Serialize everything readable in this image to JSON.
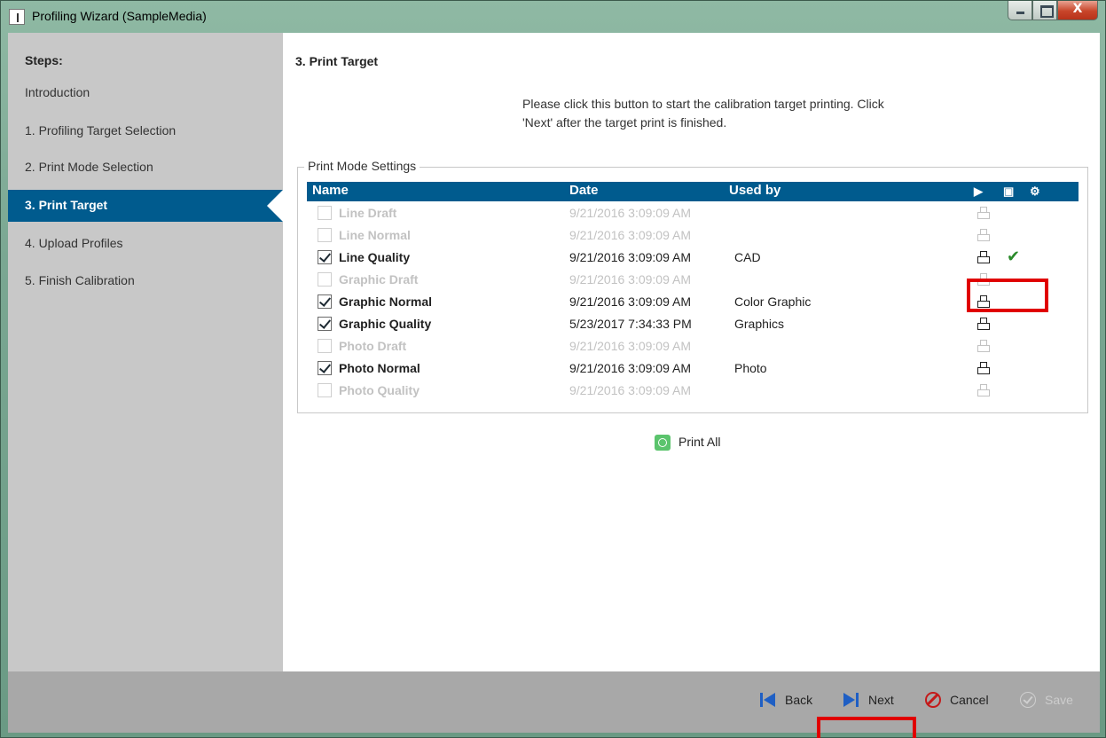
{
  "window": {
    "title": "Profiling Wizard (SampleMedia)",
    "close_glyph": "X"
  },
  "sidebar": {
    "title": "Steps:",
    "items": [
      {
        "label": "Introduction"
      },
      {
        "label": "1. Profiling Target Selection"
      },
      {
        "label": "2. Print Mode Selection"
      },
      {
        "label": "3. Print Target",
        "active": true
      },
      {
        "label": "4. Upload Profiles"
      },
      {
        "label": "5. Finish Calibration"
      }
    ]
  },
  "main": {
    "title": "3. Print Target",
    "instructions": "Please click this button to start the calibration target printing. Click 'Next' after the target print is finished.",
    "group_label": "Print Mode Settings",
    "columns": {
      "name": "Name",
      "date": "Date",
      "used_by": "Used by",
      "icons": [
        "play-icon",
        "print-icon",
        "settings-icon"
      ]
    },
    "rows": [
      {
        "name": "Line Draft",
        "date": "9/21/2016 3:09:09 AM",
        "used_by": "",
        "checked": false,
        "enabled": false,
        "done": false
      },
      {
        "name": "Line Normal",
        "date": "9/21/2016 3:09:09 AM",
        "used_by": "",
        "checked": false,
        "enabled": false,
        "done": false
      },
      {
        "name": "Line Quality",
        "date": "9/21/2016 3:09:09 AM",
        "used_by": "CAD",
        "checked": true,
        "enabled": true,
        "done": true
      },
      {
        "name": "Graphic Draft",
        "date": "9/21/2016 3:09:09 AM",
        "used_by": "",
        "checked": false,
        "enabled": false,
        "done": false
      },
      {
        "name": "Graphic Normal",
        "date": "9/21/2016 3:09:09 AM",
        "used_by": "Color Graphic",
        "checked": true,
        "enabled": true,
        "done": false
      },
      {
        "name": "Graphic Quality",
        "date": "5/23/2017 7:34:33 PM",
        "used_by": "Graphics",
        "checked": true,
        "enabled": true,
        "done": false
      },
      {
        "name": "Photo Draft",
        "date": "9/21/2016 3:09:09 AM",
        "used_by": "",
        "checked": false,
        "enabled": false,
        "done": false
      },
      {
        "name": "Photo Normal",
        "date": "9/21/2016 3:09:09 AM",
        "used_by": "Photo",
        "checked": true,
        "enabled": true,
        "done": false
      },
      {
        "name": "Photo Quality",
        "date": "9/21/2016 3:09:09 AM",
        "used_by": "",
        "checked": false,
        "enabled": false,
        "done": false
      }
    ],
    "print_all": "Print All"
  },
  "footer": {
    "back": "Back",
    "next": "Next",
    "cancel": "Cancel",
    "save": "Save"
  },
  "colors": {
    "accent": "#005b8e",
    "highlight": "#e00000",
    "success": "#2a8a2a"
  }
}
